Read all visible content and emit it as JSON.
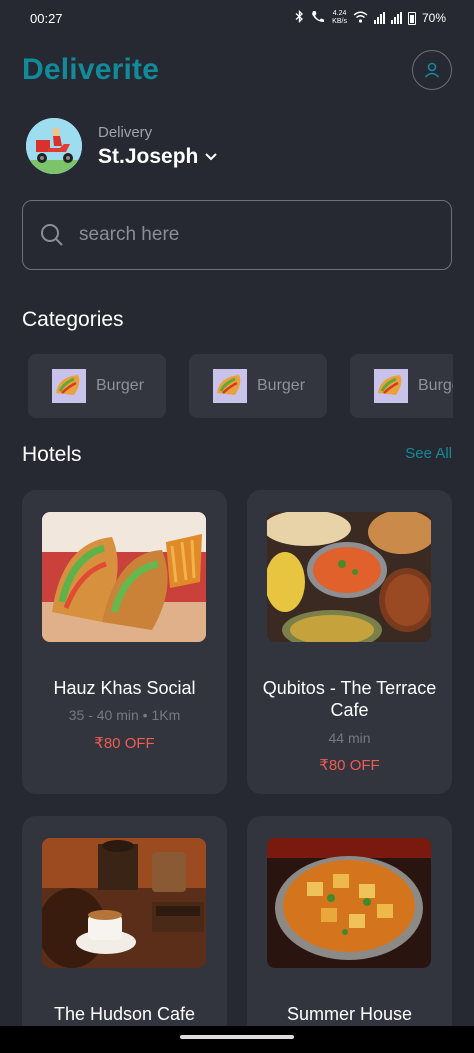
{
  "status_bar": {
    "time": "00:27",
    "speed_value": "4.24",
    "speed_unit": "KB/s",
    "battery": "70%"
  },
  "header": {
    "brand": "Deliverite"
  },
  "delivery": {
    "label": "Delivery",
    "location": "St.Joseph"
  },
  "search": {
    "placeholder": "search here"
  },
  "categories": {
    "title": "Categories",
    "items": [
      {
        "label": "Burger"
      },
      {
        "label": "Burger"
      },
      {
        "label": "Burger"
      }
    ]
  },
  "hotels": {
    "title": "Hotels",
    "see_all": "See All",
    "items": [
      {
        "name": "Hauz Khas Social",
        "meta": "35 - 40 min • 1Km",
        "offer": "₹80 OFF"
      },
      {
        "name": "Qubitos - The Terrace Cafe",
        "meta": "44 min",
        "offer": "₹80 OFF"
      },
      {
        "name": "The Hudson Cafe"
      },
      {
        "name": "Summer House"
      }
    ]
  },
  "colors": {
    "accent": "#118a9a",
    "offer": "#ee5c52",
    "background": "#272932",
    "card": "#32343e"
  }
}
